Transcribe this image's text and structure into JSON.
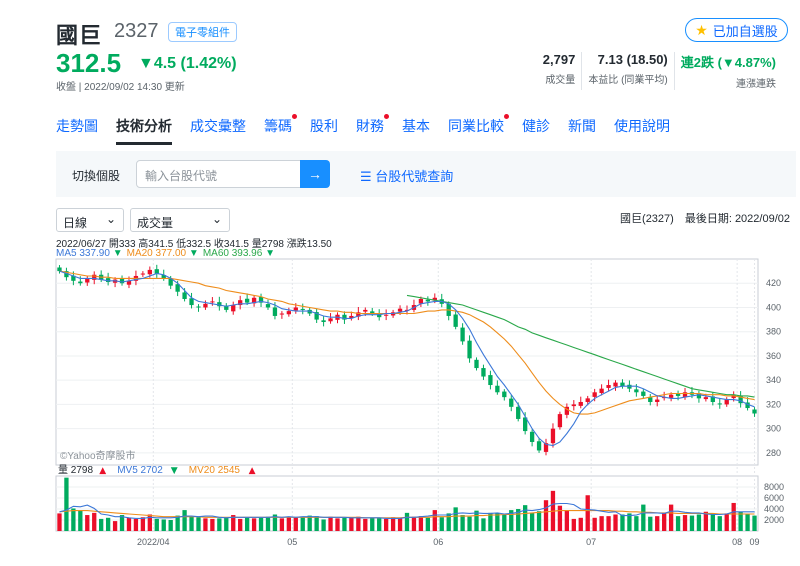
{
  "stock": {
    "name": "國巨",
    "code": "2327",
    "tag": "電子零組件",
    "favorite": "已加自選股",
    "price": "312.5",
    "change": "▼4.5 (1.42%)",
    "updated": "收盤 | 2022/09/02 14:30 更新"
  },
  "stats": [
    {
      "value": "2,797",
      "label": "成交量"
    },
    {
      "value": "7.13 (18.50)",
      "label": "本益比 (同業平均)"
    },
    {
      "value": "連2跌 (▼4.87%)",
      "label": "連漲連跌"
    }
  ],
  "nav": [
    "走勢圖",
    "技術分析",
    "成交彙整",
    "籌碼",
    "股利",
    "財務",
    "基本",
    "同業比較",
    "健診",
    "新聞",
    "使用說明"
  ],
  "search": {
    "label": "切換個股",
    "placeholder": "輸入台股代號",
    "link": "台股代號查詢"
  },
  "controls": {
    "period": "日線",
    "indicator": "成交量"
  },
  "info": "國巨(2327)　最後日期: 2022/09/02",
  "ohlc": "2022/06/27 開333 高341.5 低332.5 收341.5 量2798 漲跌13.50",
  "ma_legend": [
    {
      "text": "MA5 337.90",
      "arrow": "▼",
      "color": "#3c78d8"
    },
    {
      "text": "MA20 377.00",
      "arrow": "▼",
      "color": "#ee8d1c"
    },
    {
      "text": "MA60 393.96",
      "arrow": "▼",
      "color": "#2aa84a"
    }
  ],
  "vol_legend": [
    {
      "text": "量 2798",
      "arrow": "▲",
      "color": "#232a31"
    },
    {
      "text": "MV5 2702",
      "arrow": "▼",
      "color": "#3c78d8"
    },
    {
      "text": "MV20 2545",
      "arrow": "▲",
      "color": "#ee8d1c"
    }
  ],
  "watermark": "©Yahoo奇摩股市",
  "colors": {
    "up": "#eb0f29",
    "down": "#00ab5e",
    "ma5": "#3c78d8",
    "ma20": "#ee8d1c",
    "ma60": "#2aa84a"
  },
  "chart_data": [
    {
      "type": "candlestick",
      "title": "國巨(2327) 日線",
      "ylim": [
        270,
        440
      ],
      "yticks": [
        280,
        300,
        320,
        340,
        360,
        380,
        400,
        420
      ],
      "x_ticks": [
        "2022/04",
        "05",
        "06",
        "07",
        "08",
        "09"
      ],
      "close": [
        430,
        425,
        422,
        420,
        424,
        427,
        423,
        421,
        423,
        420,
        422,
        426,
        428,
        431,
        428,
        424,
        418,
        413,
        407,
        402,
        400,
        403,
        405,
        401,
        398,
        402,
        406,
        404,
        408,
        404,
        400,
        393,
        395,
        397,
        400,
        398,
        395,
        390,
        388,
        391,
        394,
        390,
        393,
        396,
        398,
        395,
        392,
        394,
        396,
        399,
        398,
        402,
        407,
        405,
        408,
        403,
        393,
        384,
        372,
        358,
        350,
        343,
        336,
        330,
        326,
        318,
        308,
        298,
        289,
        282,
        288,
        300,
        312,
        318,
        320,
        322,
        325,
        330,
        333,
        336,
        338,
        335,
        333,
        330,
        327,
        322,
        324,
        326,
        328,
        327,
        330,
        328,
        325,
        326,
        322,
        320,
        324,
        328,
        321,
        317,
        312.5
      ],
      "ma5": [
        430,
        428,
        426,
        424,
        424,
        424,
        423,
        422,
        422,
        421,
        422,
        423,
        424,
        426,
        428,
        427,
        424,
        420,
        414,
        408,
        405,
        404,
        403,
        402,
        401,
        402,
        403,
        403,
        404,
        405,
        404,
        402,
        399,
        398,
        397,
        397,
        397,
        395,
        393,
        392,
        392,
        391,
        391,
        393,
        394,
        394,
        394,
        395,
        395,
        396,
        397,
        400,
        403,
        404,
        405,
        405,
        403,
        398,
        391,
        382,
        371,
        361,
        352,
        343,
        336,
        328,
        320,
        310,
        300,
        292,
        287,
        286,
        289,
        296,
        304,
        314,
        320,
        325,
        328,
        331,
        334,
        335,
        335,
        335,
        333,
        330,
        327,
        326,
        325,
        325,
        326,
        327,
        328,
        327,
        326,
        325,
        324,
        324,
        323,
        320,
        318
      ],
      "ma20": [
        430,
        429,
        428,
        427,
        426,
        426,
        425,
        425,
        424,
        424,
        424,
        424,
        424,
        424,
        424,
        424,
        424,
        423,
        422,
        421,
        420,
        418,
        417,
        416,
        414,
        413,
        412,
        411,
        410,
        409,
        407,
        406,
        405,
        403,
        402,
        401,
        400,
        399,
        398,
        397,
        397,
        396,
        396,
        395,
        395,
        395,
        395,
        395,
        395,
        395,
        395,
        395,
        396,
        397,
        397,
        398,
        398,
        397,
        396,
        394,
        391,
        388,
        384,
        379,
        374,
        368,
        361,
        354,
        346,
        338,
        331,
        325,
        320,
        316,
        313,
        312,
        312,
        313,
        315,
        317,
        319,
        321,
        323,
        324,
        325,
        326,
        327,
        328,
        329,
        329,
        329,
        329,
        329,
        328,
        328,
        328,
        327,
        327,
        326,
        325,
        324
      ],
      "ma60": [
        null,
        null,
        null,
        null,
        null,
        null,
        null,
        null,
        null,
        null,
        null,
        null,
        null,
        null,
        null,
        null,
        null,
        null,
        null,
        null,
        null,
        null,
        null,
        null,
        null,
        null,
        null,
        null,
        null,
        null,
        null,
        null,
        null,
        null,
        null,
        null,
        null,
        null,
        null,
        null,
        null,
        null,
        null,
        null,
        null,
        null,
        null,
        null,
        null,
        null,
        410,
        409,
        408,
        407,
        406,
        405,
        404,
        403,
        402,
        400,
        398,
        396,
        394,
        392,
        390,
        387,
        384,
        382,
        379,
        377,
        375,
        373,
        371,
        369,
        367,
        365,
        363,
        361,
        359,
        357,
        355,
        353,
        351,
        349,
        347,
        345,
        343,
        341,
        339,
        337,
        335,
        333,
        332,
        331,
        330,
        329,
        328,
        328,
        327,
        327,
        326
      ]
    },
    {
      "type": "bar",
      "title": "成交量",
      "ylim": [
        0,
        10000
      ],
      "yticks": [
        2000,
        4000,
        6000,
        8000
      ],
      "volume": [
        3200,
        9700,
        4100,
        3800,
        2900,
        3300,
        2200,
        2400,
        1800,
        2900,
        2400,
        2200,
        2500,
        3000,
        2200,
        2100,
        2000,
        2800,
        3800,
        2700,
        2500,
        2300,
        2200,
        2300,
        2400,
        2900,
        2200,
        2500,
        2300,
        2400,
        2600,
        3000,
        2300,
        2600,
        2400,
        2500,
        2800,
        2700,
        2100,
        2600,
        2300,
        2400,
        2400,
        2600,
        2200,
        2400,
        2300,
        2200,
        2500,
        2300,
        3300,
        2600,
        2700,
        2400,
        3800,
        2500,
        3200,
        4300,
        2900,
        2600,
        3700,
        2300,
        3300,
        3300,
        3000,
        3800,
        4000,
        4700,
        3300,
        3600,
        5600,
        7300,
        4600,
        3800,
        2200,
        2400,
        6500,
        2400,
        2700,
        2700,
        3000,
        3000,
        3200,
        2700,
        4800,
        2600,
        2700,
        3200,
        4800,
        2700,
        2900,
        2800,
        3000,
        3500,
        3100,
        2700,
        3200,
        5100,
        3500,
        3100,
        2798
      ],
      "mv5": [
        3500,
        3800,
        4500,
        4400,
        4700,
        4100,
        3100,
        2900,
        2600,
        2600,
        2400,
        2300,
        2300,
        2500,
        2400,
        2400,
        2400,
        2500,
        2700,
        2700,
        2600,
        2700,
        2700,
        2500,
        2400,
        2500,
        2500,
        2500,
        2500,
        2500,
        2500,
        2600,
        2500,
        2600,
        2500,
        2600,
        2600,
        2600,
        2500,
        2500,
        2500,
        2500,
        2400,
        2400,
        2400,
        2400,
        2400,
        2300,
        2300,
        2300,
        2500,
        2500,
        2600,
        2700,
        2900,
        2900,
        2900,
        3200,
        3300,
        3200,
        3300,
        3200,
        3200,
        3300,
        3100,
        3200,
        3400,
        3800,
        3700,
        3900,
        4200,
        4900,
        5000,
        5000,
        4800,
        4000,
        3900,
        3800,
        3600,
        3400,
        3500,
        2800,
        2800,
        2900,
        3300,
        3300,
        3300,
        3200,
        3600,
        3600,
        3400,
        3300,
        3300,
        3100,
        3000,
        3000,
        3100,
        3500,
        3500,
        3500,
        3500
      ],
      "mv20": [
        3500,
        3600,
        3700,
        3700,
        3700,
        3600,
        3500,
        3400,
        3300,
        3200,
        3100,
        3000,
        2900,
        2800,
        2700,
        2600,
        2600,
        2600,
        2600,
        2600,
        2600,
        2500,
        2500,
        2500,
        2500,
        2500,
        2500,
        2500,
        2500,
        2500,
        2500,
        2500,
        2500,
        2500,
        2500,
        2500,
        2500,
        2500,
        2500,
        2500,
        2500,
        2500,
        2500,
        2500,
        2400,
        2400,
        2400,
        2400,
        2400,
        2400,
        2500,
        2500,
        2500,
        2500,
        2600,
        2600,
        2600,
        2700,
        2700,
        2700,
        2800,
        2800,
        2900,
        2900,
        3000,
        3000,
        3100,
        3200,
        3300,
        3400,
        3500,
        3600,
        3700,
        3700,
        3700,
        3700,
        3700,
        3700,
        3700,
        3700,
        3600,
        3600,
        3500,
        3500,
        3400,
        3400,
        3300,
        3300,
        3300,
        3200,
        3200,
        3200,
        3200,
        3200,
        3200,
        3100,
        3100,
        3100,
        3100,
        3100,
        3100
      ]
    }
  ]
}
